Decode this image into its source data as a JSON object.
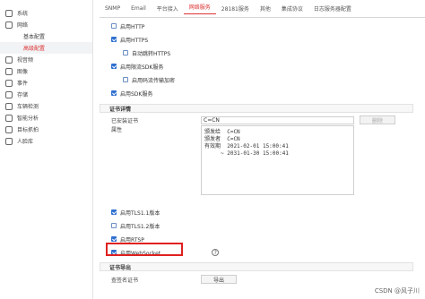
{
  "sidebar": {
    "items": [
      {
        "label": "系统",
        "icon": "system-icon"
      },
      {
        "label": "网络",
        "icon": "network-icon"
      },
      {
        "label": "基本配置",
        "sub": true
      },
      {
        "label": "高级配置",
        "sub": true,
        "active": true
      },
      {
        "label": "视音频",
        "icon": "video-audio-icon"
      },
      {
        "label": "图像",
        "icon": "image-icon"
      },
      {
        "label": "事件",
        "icon": "event-icon"
      },
      {
        "label": "存储",
        "icon": "storage-icon"
      },
      {
        "label": "车辆检测",
        "icon": "vehicle-icon"
      },
      {
        "label": "智能分析",
        "icon": "analytics-icon"
      },
      {
        "label": "目标抓拍",
        "icon": "capture-icon"
      },
      {
        "label": "人脸库",
        "icon": "face-library-icon"
      }
    ]
  },
  "tabs": [
    {
      "label": "SNMP"
    },
    {
      "label": "Email"
    },
    {
      "label": "平台接入"
    },
    {
      "label": "网络服务",
      "active": true
    },
    {
      "label": "28181服务"
    },
    {
      "label": "其他"
    },
    {
      "label": "集成协议"
    },
    {
      "label": "日志服务器配置"
    }
  ],
  "services": {
    "http": {
      "label": "启用HTTP",
      "checked": false
    },
    "https": {
      "label": "启用HTTPS",
      "checked": true
    },
    "auto_https": {
      "label": "自动跳转HTTPS",
      "checked": false
    },
    "sdk_rate": {
      "label": "启用限流SDK服务",
      "checked": true
    },
    "stream_encrypt": {
      "label": "启用码流传输加密",
      "checked": false
    },
    "sdk": {
      "label": "启用SDK服务",
      "checked": true
    }
  },
  "cert": {
    "section_title": "证书详情",
    "installed_label": "已安装证书",
    "installed_value": "C=CN",
    "delete_label": "删除",
    "attr_label": "属性",
    "attr_text": "颁发给  C=CN\n颁发者  C=CN\n有效期  2021-02-01 15:00:41\n     ~ 2031-01-30 15:00:41"
  },
  "tls": {
    "tls11": {
      "label": "启用TLS1.1版本",
      "checked": true
    },
    "tls12": {
      "label": "启用TLS1.2版本",
      "checked": false
    },
    "rtsp": {
      "label": "启用RTSP",
      "checked": true
    },
    "websocket": {
      "label": "启用WebSocket",
      "checked": true
    }
  },
  "export": {
    "section_title": "证书导出",
    "label": "查签名证书",
    "button": "导出"
  },
  "watermark": "CSDN @风子川",
  "colors": {
    "accent": "#d33",
    "checkbox": "#2f6fcf",
    "highlight_box": "#e02020"
  }
}
